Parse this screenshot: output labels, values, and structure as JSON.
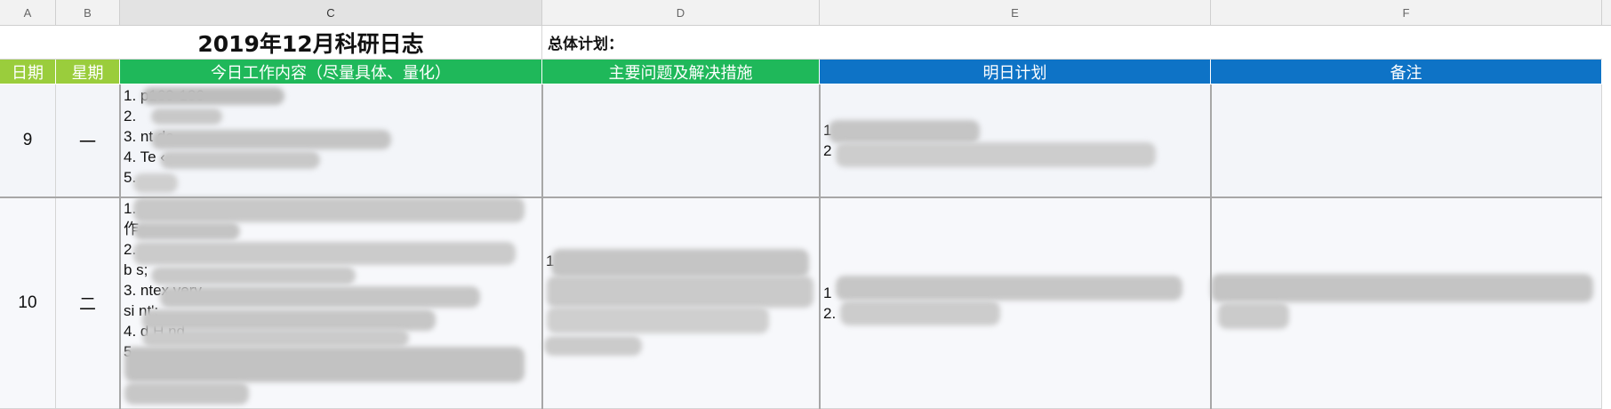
{
  "columns": [
    "A",
    "B",
    "C",
    "D",
    "E",
    "F"
  ],
  "sheet_title": "2019年12月科研日志",
  "overall_plan_label": "总体计划：",
  "headers": {
    "date": "日期",
    "weekday": "星期",
    "today_work": "今日工作内容（尽量具体、量化）",
    "issues": "主要问题及解决措施",
    "tomorrow": "明日计划",
    "notes": "备注"
  },
  "rows": [
    {
      "date": "9",
      "weekday": "一",
      "work_lines": [
        "1.                   p160-186",
        "2.",
        "3.          nt de",
        "4. Te                    ‹",
        "5."
      ],
      "issue_lines": [],
      "plan_lines": [
        "1",
        "2"
      ],
      "note_lines": []
    },
    {
      "date": "10",
      "weekday": "二",
      "work_lines": [
        "1.",
        "作",
        "2.",
        "b                  s;",
        "3.                                        ntex very",
        "si                                          nt';",
        "4.                          d H   nd",
        "5.                                          —",
        ""
      ],
      "issue_lines": [
        "1",
        "",
        "",
        ""
      ],
      "plan_lines": [
        "1",
        "2."
      ],
      "note_lines": [
        ""
      ]
    }
  ]
}
